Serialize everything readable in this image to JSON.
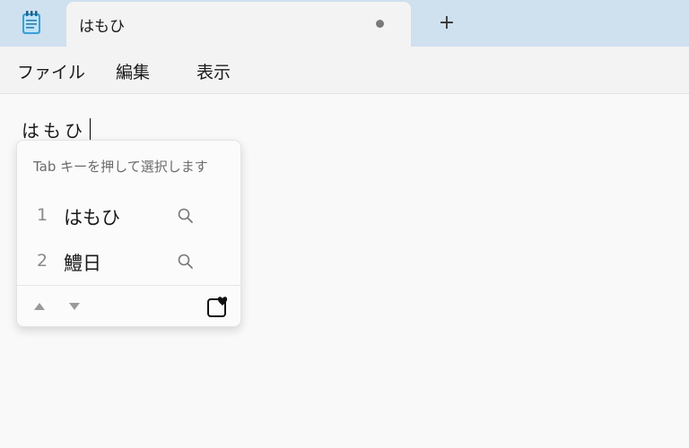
{
  "window": {
    "app_icon": "notepad-icon",
    "tab_title": "はもひ",
    "tab_modified_indicator": "dot-icon",
    "new_tab_label": "+"
  },
  "menu": {
    "items": [
      {
        "label": "ファイル"
      },
      {
        "label": "編集"
      },
      {
        "label": "表示"
      }
    ]
  },
  "editor": {
    "composing_text": "はもひ"
  },
  "ime": {
    "hint": "Tab キーを押して選択します",
    "candidates": [
      {
        "number": "1",
        "text": "はもひ",
        "icon": "search-icon"
      },
      {
        "number": "2",
        "text": "鱧日",
        "icon": "search-icon"
      }
    ],
    "footer_icons": [
      "triangle-up-icon",
      "triangle-down-icon",
      "favorite-icon"
    ]
  },
  "colors": {
    "titlebar": "#cfe0ef",
    "tab": "#f3f3f3",
    "editor": "#f9f9f9"
  }
}
